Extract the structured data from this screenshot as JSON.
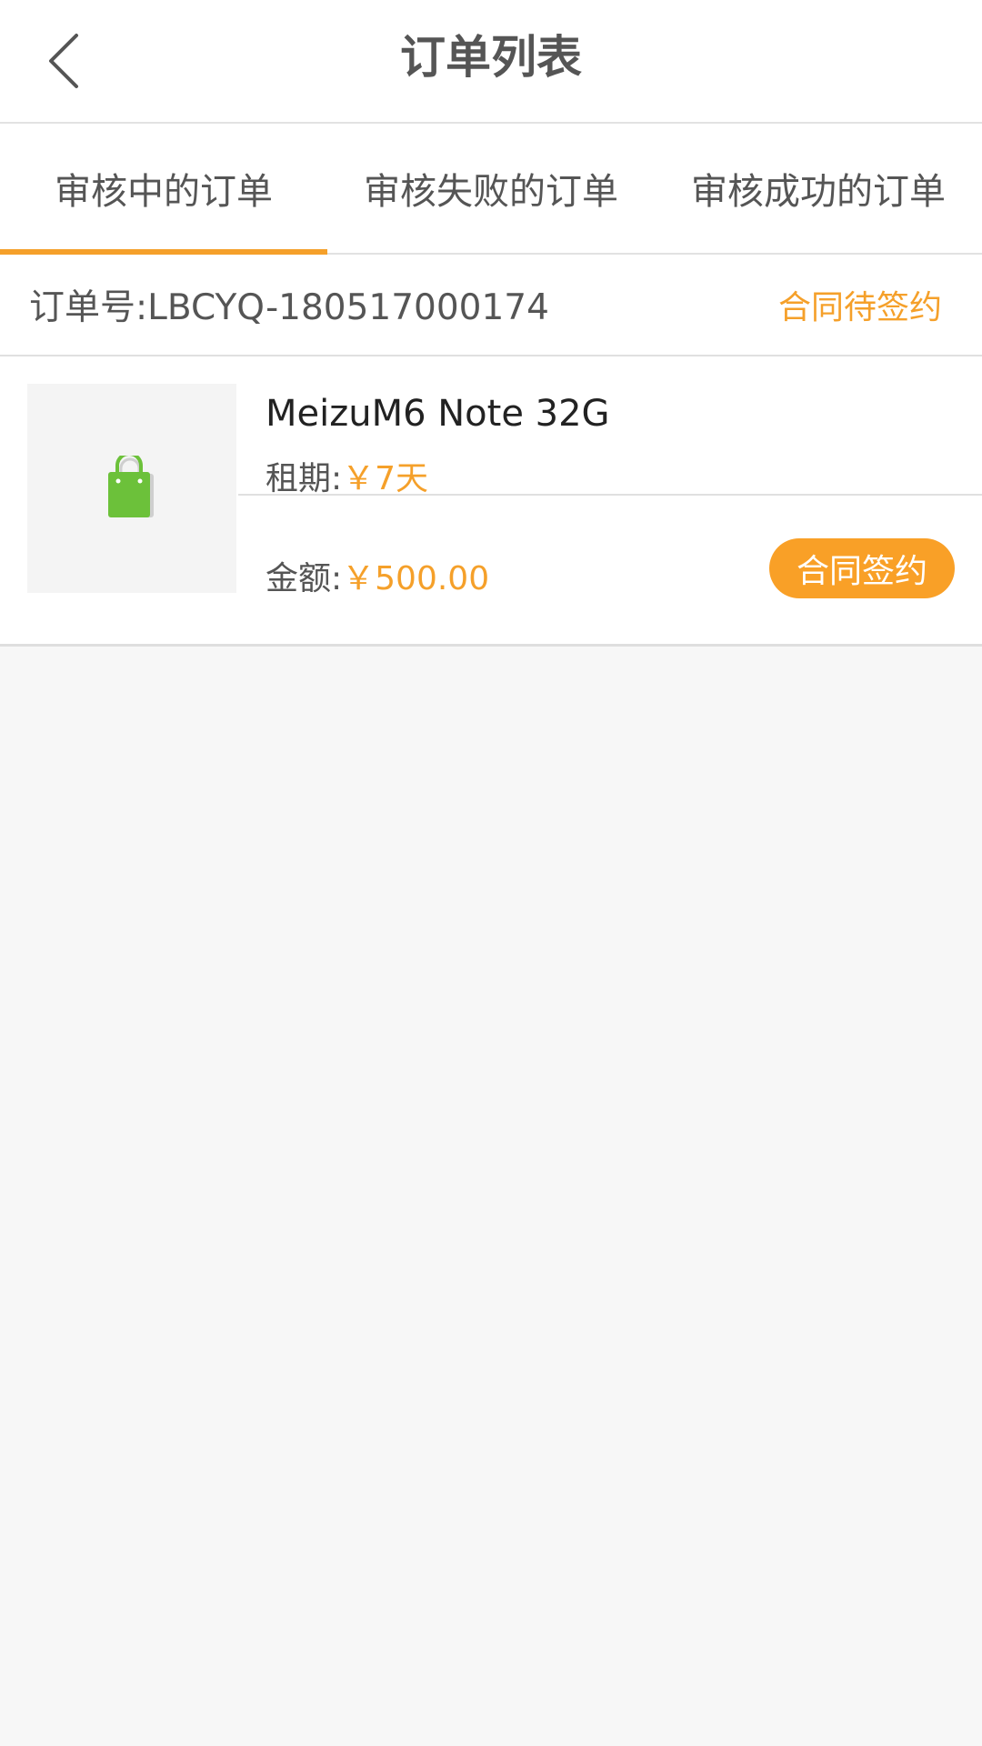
{
  "header": {
    "title": "订单列表",
    "back_icon": "chevron-left-icon"
  },
  "tabs": [
    {
      "label": "审核中的订单",
      "active": true
    },
    {
      "label": "审核失败的订单",
      "active": false
    },
    {
      "label": "审核成功的订单",
      "active": false
    }
  ],
  "order": {
    "order_no": "订单号:LBCYQ-180517000174",
    "status": "合同待签约",
    "thumbnail_icon": "shopping-bag-icon",
    "product_name": "MeizuM6 Note 32G",
    "rent_label": "租期:",
    "rent_value": "￥7天",
    "amount_label": "金额:",
    "amount_value": "￥500.00",
    "action_label": "合同签约"
  },
  "colors": {
    "accent": "#f5a02a",
    "button": "#f9a027",
    "bag_green": "#6cc13a",
    "background": "#f7f7f7"
  }
}
